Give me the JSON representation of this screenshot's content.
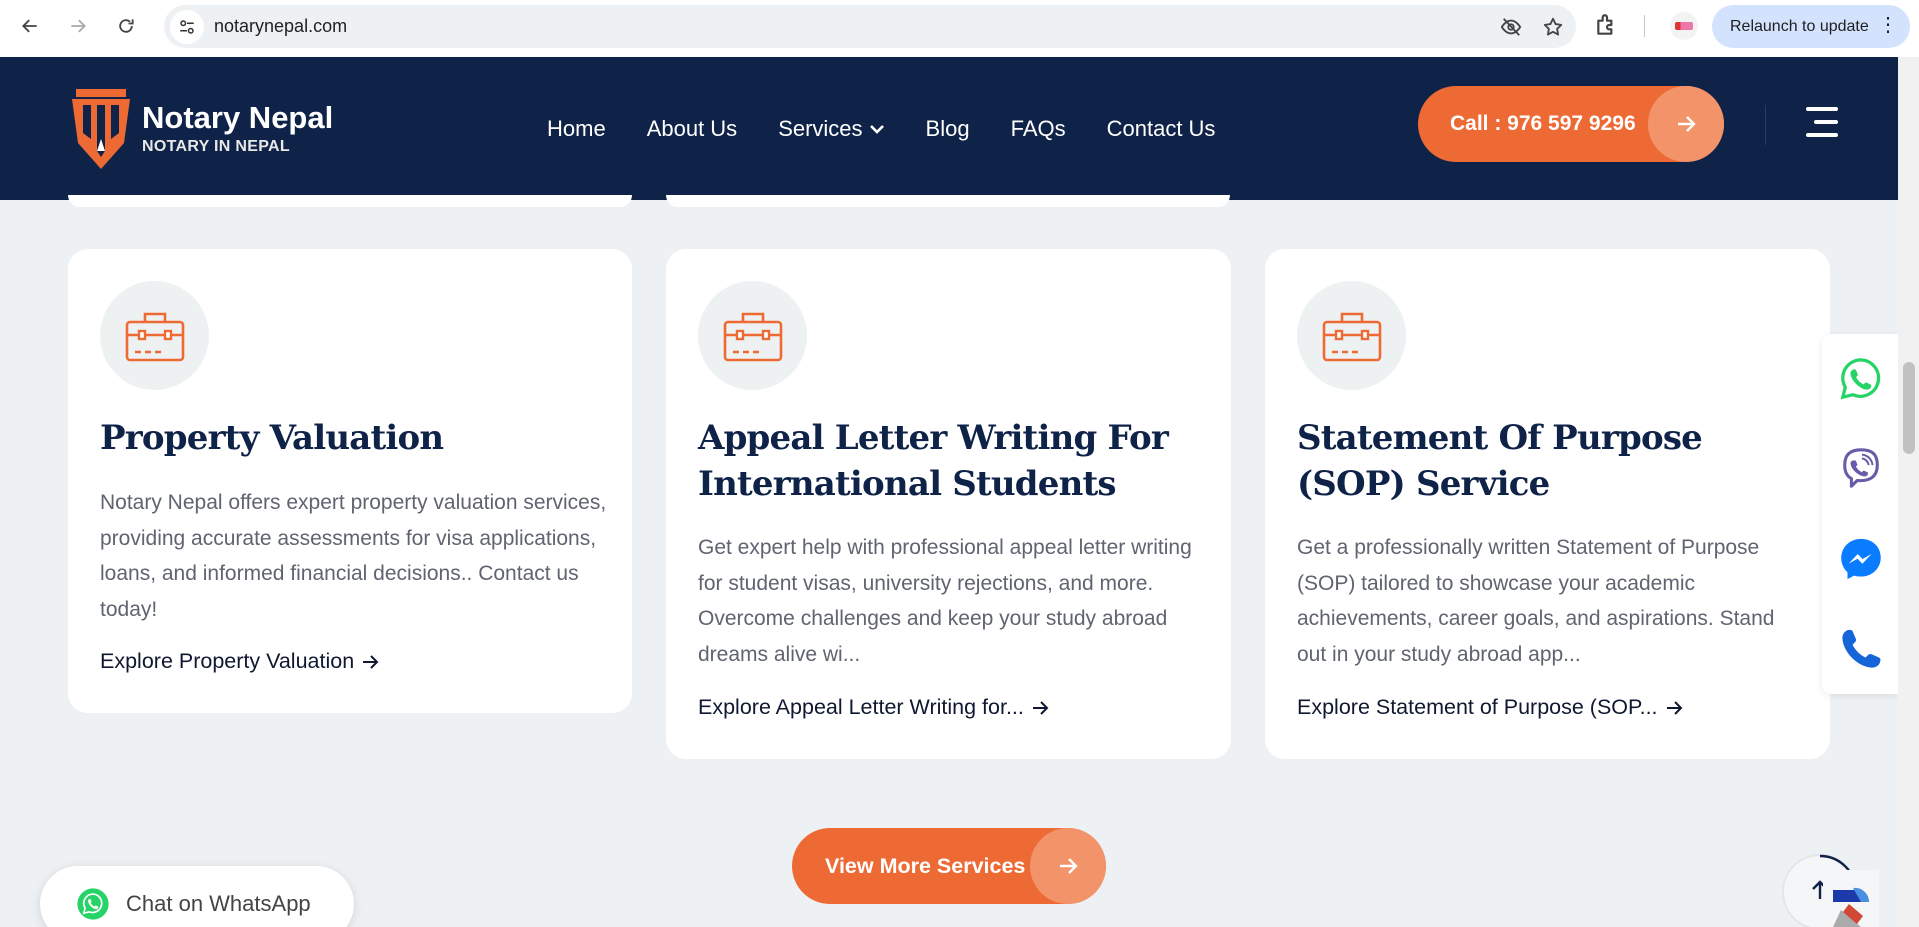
{
  "browser": {
    "url": "notarynepal.com",
    "relaunch_label": "Relaunch to update"
  },
  "site": {
    "logo_title": "Notary Nepal",
    "logo_subtitle": "NOTARY IN NEPAL",
    "nav": {
      "home": "Home",
      "about": "About Us",
      "services": "Services",
      "blog": "Blog",
      "faqs": "FAQs",
      "contact": "Contact Us"
    },
    "call_label": "Call : 976 597 9296"
  },
  "cards": [
    {
      "title": "Property Valuation",
      "description": "Notary Nepal offers expert property valuation services, providing accurate assessments for visa applications, loans, and informed financial decisions.. Contact us today!",
      "link": "Explore Property Valuation"
    },
    {
      "title": "Appeal Letter Writing For International Students",
      "description": "Get expert help with professional appeal letter writing for student visas, university rejections, and more. Overcome challenges and keep your study abroad dreams alive wi...",
      "link": "Explore Appeal Letter Writing for..."
    },
    {
      "title": "Statement Of Purpose (SOP) Service",
      "description": "Get a professionally written Statement of Purpose (SOP) tailored to showcase your academic achievements, career goals, and aspirations. Stand out in your study abroad app...",
      "link": "Explore Statement of Purpose (SOP..."
    }
  ],
  "view_more_label": "View More Services",
  "chat_whatsapp_label": "Chat on WhatsApp",
  "colors": {
    "navy": "#0f2248",
    "accent": "#ee6a35",
    "accent_light": "#f3936a",
    "page_bg": "#edf1f3",
    "whatsapp": "#25d366",
    "viber": "#665ca7",
    "messenger": "#0a7cff",
    "phone": "#1565d8"
  },
  "icons": {
    "card_icon": "briefcase-icon",
    "social": [
      "whatsapp-icon",
      "viber-icon",
      "messenger-icon",
      "phone-icon"
    ]
  }
}
